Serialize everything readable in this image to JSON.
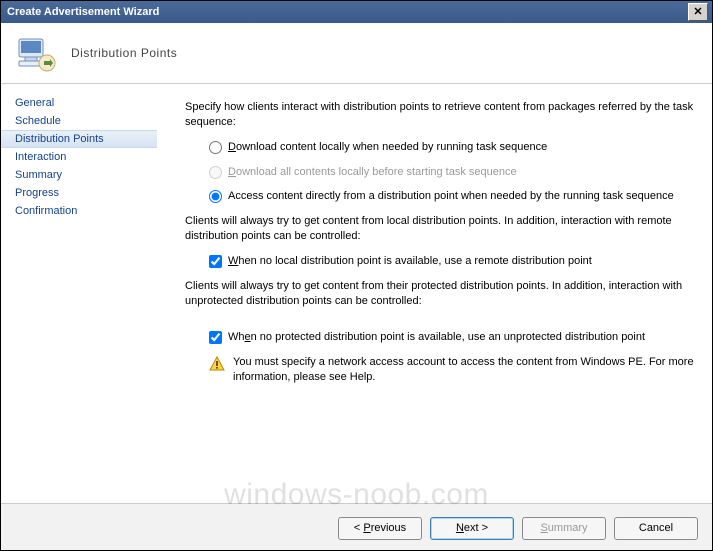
{
  "window": {
    "title": "Create Advertisement Wizard"
  },
  "header": {
    "page_title": "Distribution Points"
  },
  "sidebar": {
    "items": [
      {
        "label": "General"
      },
      {
        "label": "Schedule"
      },
      {
        "label": "Distribution Points"
      },
      {
        "label": "Interaction"
      },
      {
        "label": "Summary"
      },
      {
        "label": "Progress"
      },
      {
        "label": "Confirmation"
      }
    ],
    "active_index": 2
  },
  "content": {
    "intro": "Specify how clients interact with distribution points to retrieve content from packages referred by the task sequence:",
    "radio1": {
      "hotkey": "D",
      "rest": "ownload content locally when needed by running task sequence",
      "checked": false,
      "disabled": false
    },
    "radio2": {
      "hotkey": "D",
      "rest": "ownload all contents locally before starting task sequence",
      "checked": false,
      "disabled": true
    },
    "radio3": {
      "label": "Access content directly from a distribution point when needed by the running task sequence",
      "checked": true,
      "disabled": false
    },
    "para_local": "Clients will always try to get content from local distribution points. In addition, interaction with remote distribution points can be controlled:",
    "check_remote": {
      "hotkey": "W",
      "rest": "hen no local distribution point is available, use a remote distribution point",
      "checked": true
    },
    "para_protected": "Clients will always try to get content from their protected distribution points. In addition, interaction with unprotected distribution points can be controlled:",
    "check_unprotected": {
      "pre": "Wh",
      "hotkey": "e",
      "rest": "n no protected distribution point is available, use an unprotected distribution point",
      "checked": true
    },
    "warning": "You must specify a network access account to access the content from Windows PE.  For more information, please see Help."
  },
  "footer": {
    "previous": {
      "lt": "<",
      "space": " ",
      "hotkey": "P",
      "rest": "revious"
    },
    "next": {
      "hotkey": "N",
      "rest": "ext ",
      "gt": ">"
    },
    "summary": {
      "hotkey": "S",
      "rest": "ummary",
      "disabled": true
    },
    "cancel": "Cancel"
  },
  "watermark": "windows-noob.com"
}
